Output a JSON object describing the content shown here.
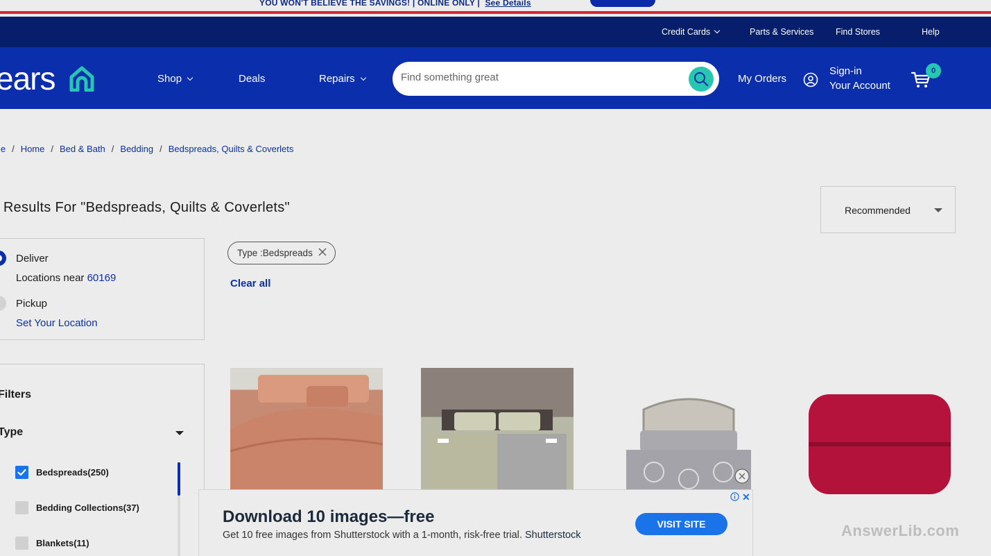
{
  "promo": {
    "text": "YOU WON'T BELIEVE THE SAVINGS! | ONLINE ONLY |",
    "link": "See Details"
  },
  "utility_nav": {
    "credit_cards": "Credit Cards",
    "parts_services": "Parts & Services",
    "find_stores": "Find Stores",
    "help": "Help"
  },
  "header": {
    "logo_text": "ears",
    "nav": {
      "shop": "Shop",
      "deals": "Deals",
      "repairs": "Repairs"
    },
    "search": {
      "placeholder": "Find something great"
    },
    "my_orders": "My Orders",
    "signin_line1": "Sign-in",
    "signin_line2": "Your Account",
    "cart_count": "0"
  },
  "breadcrumb": [
    "me",
    "Home",
    "Bed & Bath",
    "Bedding",
    "Bedspreads, Quilts & Coverlets"
  ],
  "results_title": ") Results For \"Bedspreads, Quilts & Coverlets\"",
  "sort": {
    "selected": "Recommended"
  },
  "delivery": {
    "deliver": "Deliver",
    "locations_near": "Locations near",
    "zip": "60169",
    "pickup": "Pickup",
    "set_location": "Set Your Location"
  },
  "applied_filter": {
    "label": "Type :Bedspreads",
    "clear_all": "Clear all"
  },
  "filters": {
    "title": "Filters",
    "type_title": "Type",
    "options": [
      {
        "label": "Bedspreads(250)",
        "checked": true
      },
      {
        "label": "Bedding Collections(37)",
        "checked": false
      },
      {
        "label": "Blankets(11)",
        "checked": false
      }
    ]
  },
  "ad": {
    "title": "Download 10 images—free",
    "subtitle": "Get 10 free images from Shutterstock with a 1-month, risk-free trial.",
    "brand": "Shutterstock",
    "button": "VISIT SITE"
  },
  "watermark": "AnswerLib.com",
  "colors": {
    "header_blue": "#0b2ead",
    "utility_navy": "#061e6b",
    "accent_teal": "#26c6b0",
    "promo_red": "#d8262e"
  }
}
